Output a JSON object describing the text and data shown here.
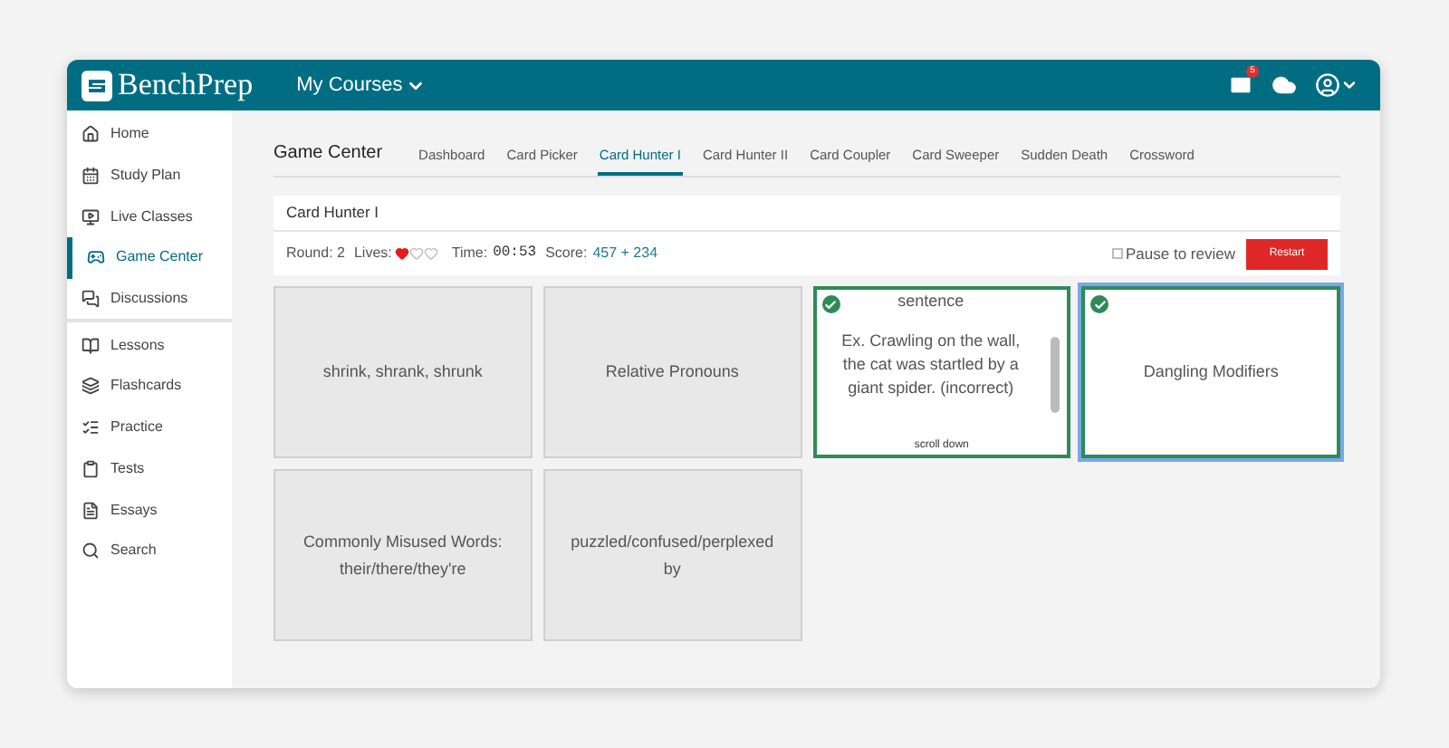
{
  "header": {
    "logo": "BenchPrep",
    "courses_menu": "My Courses",
    "mail_badge": "5"
  },
  "sidebar": {
    "groups": [
      [
        {
          "label": "Home",
          "selected": false
        },
        {
          "label": "Study Plan",
          "selected": false
        },
        {
          "label": "Live Classes",
          "selected": false
        },
        {
          "label": "Game Center",
          "selected": true
        },
        {
          "label": "Discussions",
          "selected": false
        }
      ],
      [
        {
          "label": "Lessons",
          "selected": false
        },
        {
          "label": "Flashcards",
          "selected": false
        },
        {
          "label": "Practice",
          "selected": false
        },
        {
          "label": "Tests",
          "selected": false
        },
        {
          "label": "Essays",
          "selected": false
        },
        {
          "label": "Search",
          "selected": false
        }
      ]
    ]
  },
  "page_title": "Game Center",
  "tabs": [
    {
      "label": "Dashboard",
      "selected": false
    },
    {
      "label": "Card Picker",
      "selected": false
    },
    {
      "label": "Card Hunter I",
      "selected": true
    },
    {
      "label": "Card Hunter II",
      "selected": false
    },
    {
      "label": "Card Coupler",
      "selected": false
    },
    {
      "label": "Card Sweeper",
      "selected": false
    },
    {
      "label": "Sudden Death",
      "selected": false
    },
    {
      "label": "Crossword",
      "selected": false
    }
  ],
  "game": {
    "title": "Card Hunter I",
    "round": "Round: 2",
    "lives_label": "Lives:",
    "lives": [
      {
        "filled": true
      },
      {
        "filled": false
      },
      {
        "filled": false
      }
    ],
    "time_label": "Time:",
    "time": "00:53",
    "score_label": "Score:",
    "score": "457 + 234",
    "pause": {
      "label": "Pause to review",
      "checked": false
    },
    "restart": "Restart"
  },
  "cards": [
    {
      "lines": [
        "shrink, shrank, shrunk"
      ],
      "matched": false,
      "selected": false,
      "kind": "plain"
    },
    {
      "lines": [
        "Relative Pronouns"
      ],
      "matched": false,
      "selected": false,
      "kind": "plain"
    },
    {
      "lines": [
        "sentence",
        "Ex. Crawling on the wall, the cat was startled by a giant spider. (incorrect)"
      ],
      "matched": true,
      "selected": false,
      "kind": "scroll",
      "scroll_hint": "scroll down"
    },
    {
      "lines": [
        "Dangling Modifiers"
      ],
      "matched": true,
      "selected": true,
      "kind": "plain"
    },
    {
      "lines": [
        "Commonly Misused Words: their/there/they're"
      ],
      "matched": false,
      "selected": false,
      "kind": "plain"
    },
    {
      "lines": [
        "puzzled/confused/perplexed by"
      ],
      "matched": false,
      "selected": false,
      "kind": "plain"
    }
  ]
}
